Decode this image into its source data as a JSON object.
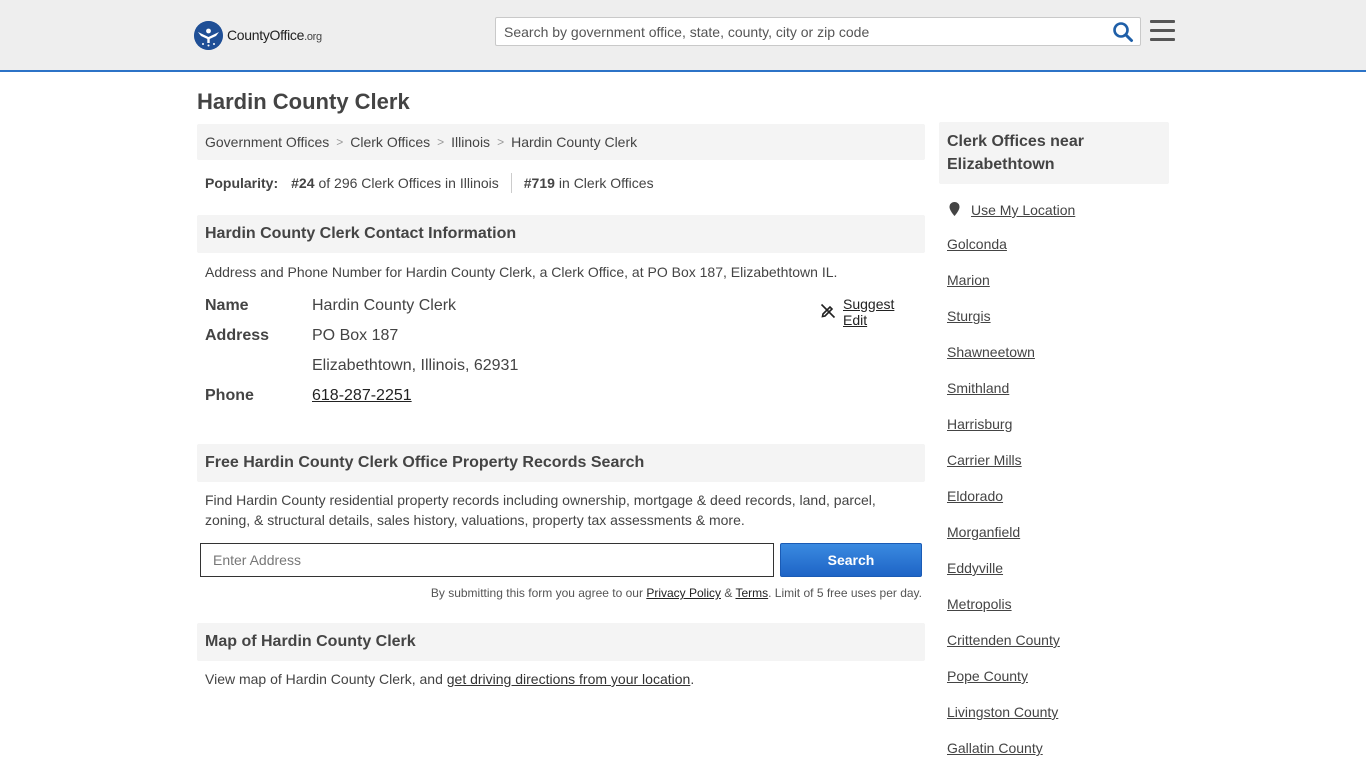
{
  "header": {
    "logo_name": "CountyOffice",
    "logo_tld": ".org",
    "search_placeholder": "Search by government office, state, county, city or zip code"
  },
  "page_title": "Hardin County Clerk",
  "breadcrumb": [
    {
      "label": "Government Offices"
    },
    {
      "label": "Clerk Offices"
    },
    {
      "label": "Illinois"
    },
    {
      "label": "Hardin County Clerk"
    }
  ],
  "popularity": {
    "label": "Popularity:",
    "state_rank": "#24",
    "state_text": "of 296 Clerk Offices in Illinois",
    "national_rank": "#719",
    "national_text": "in Clerk Offices"
  },
  "contact": {
    "heading": "Hardin County Clerk Contact Information",
    "description": "Address and Phone Number for Hardin County Clerk, a Clerk Office, at PO Box 187, Elizabethtown IL.",
    "suggest_edit": "Suggest Edit",
    "name_label": "Name",
    "name_value": "Hardin County Clerk",
    "address_label": "Address",
    "address_line1": "PO Box 187",
    "address_line2": "Elizabethtown, Illinois, 62931",
    "phone_label": "Phone",
    "phone_value": "618-287-2251"
  },
  "property": {
    "heading": "Free Hardin County Clerk Office Property Records Search",
    "description_line1": "Find Hardin County residential property records including ownership, mortgage & deed records, land, parcel,",
    "description_line2": "zoning, & structural details, sales history, valuations, property tax assessments & more.",
    "input_placeholder": "Enter Address",
    "button_label": "Search",
    "terms_prefix": "By submitting this form you agree to our ",
    "privacy_link": "Privacy Policy",
    "terms_amp": " & ",
    "terms_link": "Terms",
    "terms_suffix": ". Limit of 5 free uses per day."
  },
  "map": {
    "heading": "Map of Hardin County Clerk",
    "description_prefix": "View map of Hardin County Clerk, and ",
    "directions_link": "get driving directions from your location",
    "description_suffix": "."
  },
  "sidebar": {
    "heading": "Clerk Offices near Elizabethtown",
    "use_location": "Use My Location",
    "items": [
      "Golconda",
      "Marion",
      "Sturgis",
      "Shawneetown",
      "Smithland",
      "Harrisburg",
      "Carrier Mills",
      "Eldorado",
      "Morganfield",
      "Eddyville",
      "Metropolis",
      "Crittenden County",
      "Pope County",
      "Livingston County",
      "Gallatin County"
    ]
  },
  "colors": {
    "accent": "#2c73c7",
    "header_bg": "#eeeeee",
    "panel_bg": "#f4f4f4",
    "search_icon": "#1f5fa8",
    "button": "#1e64c6"
  }
}
